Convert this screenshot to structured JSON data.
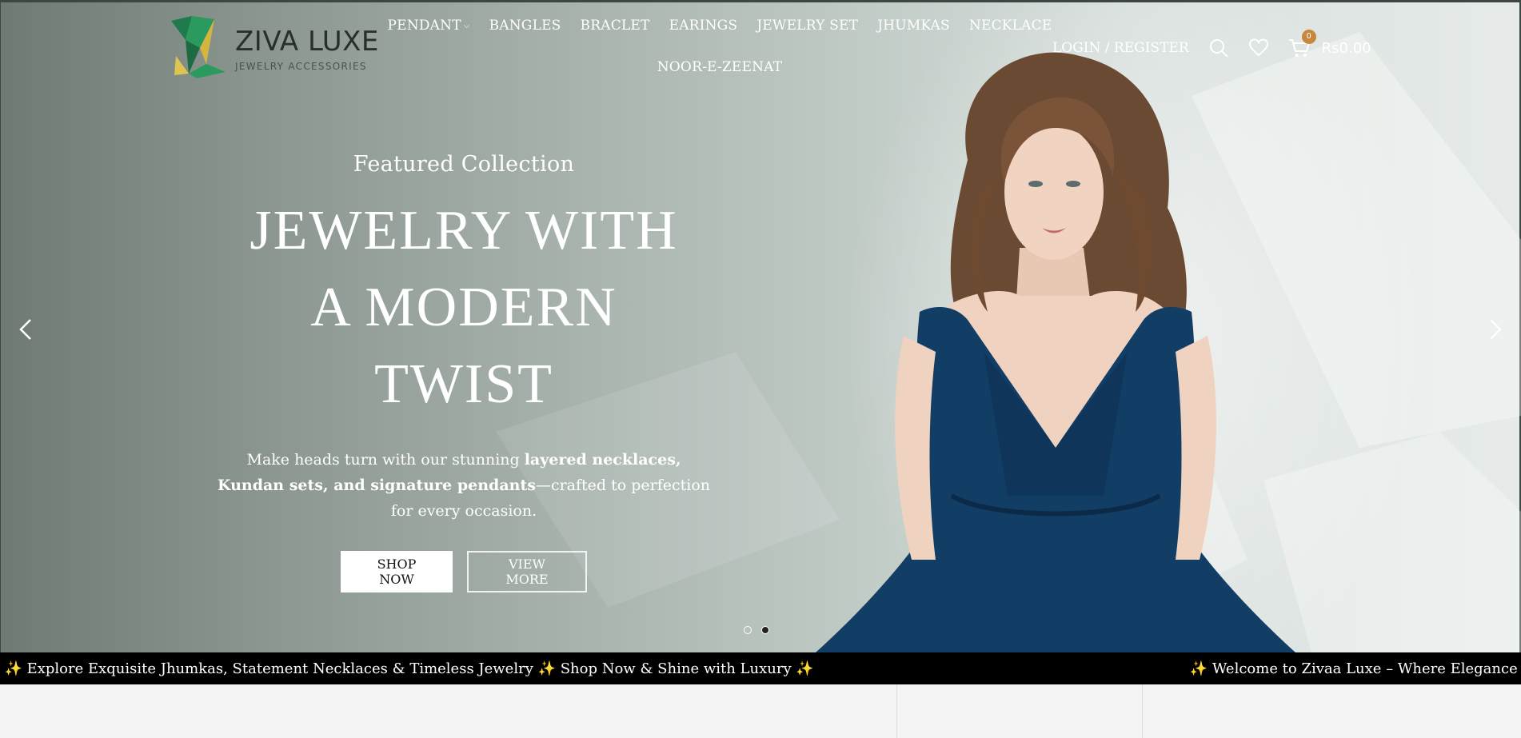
{
  "brand": {
    "name": "ZIVA LUXE",
    "tagline": "JEWELRY ACCESSORIES"
  },
  "nav": {
    "row1": [
      {
        "label": "PENDANT",
        "has_dropdown": true
      },
      {
        "label": "BANGLES"
      },
      {
        "label": "BRACLET"
      },
      {
        "label": "EARINGS"
      },
      {
        "label": "JEWELRY SET"
      },
      {
        "label": "JHUMKAS"
      },
      {
        "label": "NECKLACE"
      }
    ],
    "row2": [
      {
        "label": "NOOR-E-ZEENAT"
      }
    ]
  },
  "header": {
    "login_label": "LOGIN / REGISTER",
    "cart_count": "0",
    "cart_total": "Rs0.00"
  },
  "hero": {
    "eyebrow": "Featured Collection",
    "headline_line1": "JEWELRY WITH",
    "headline_line2": "A MODERN TWIST",
    "sub_part1": "Make heads turn with our stunning ",
    "sub_bold": "layered necklaces, Kundan sets, and signature pendants",
    "sub_part2": "—crafted to perfection for every occasion.",
    "primary_button": "SHOP NOW",
    "secondary_button": "VIEW MORE",
    "slide_count": 2,
    "active_slide": 2
  },
  "ticker": {
    "text1": "ı ✨ Explore Exquisite Jhumkas, Statement Necklaces & Timeless Jewelry ✨ Shop Now & Shine with Luxury ✨",
    "text2": "✨ Welcome to Zivaa Luxe – Where Elegance Meets Tradit"
  },
  "colors": {
    "accent_badge": "#c8873a",
    "ticker_bg": "#000000",
    "dress": "#123d64"
  },
  "icons": [
    "chevron-down-icon",
    "search-icon",
    "heart-icon",
    "cart-icon",
    "arrow-left-icon",
    "arrow-right-icon"
  ]
}
